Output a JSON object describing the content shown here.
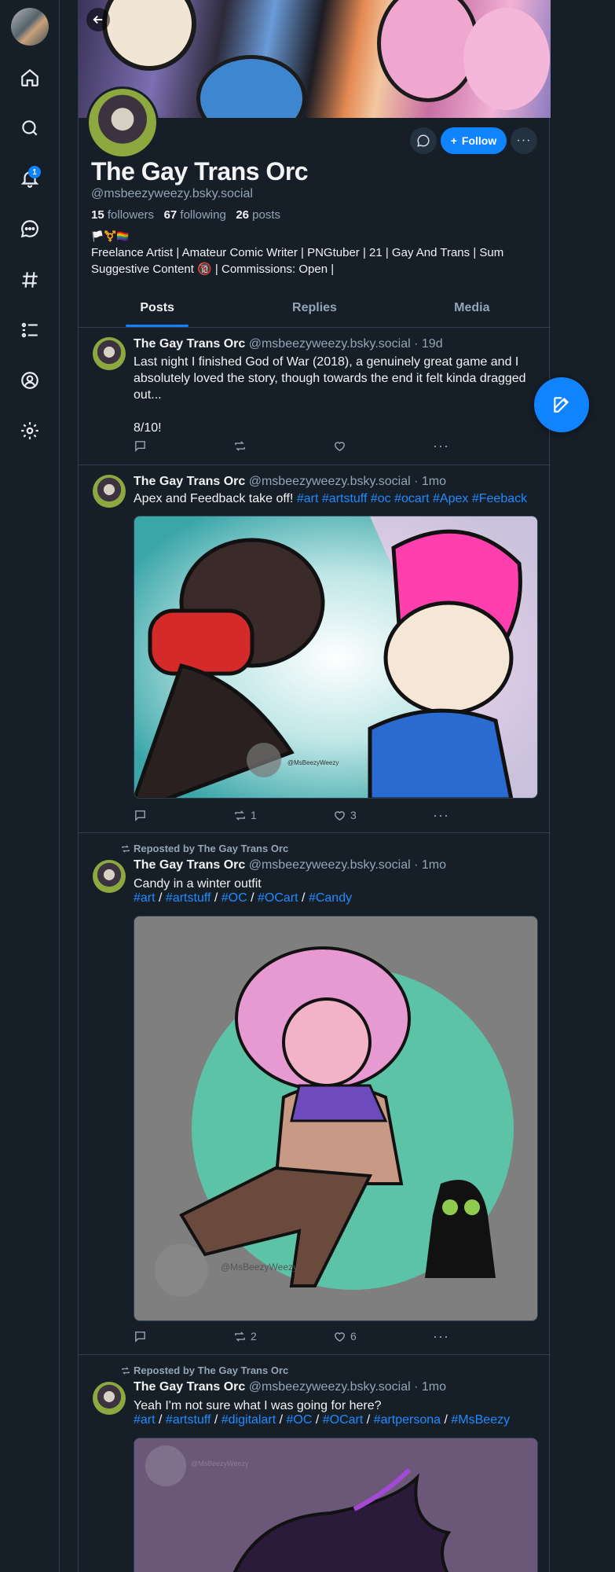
{
  "nav": {
    "notifications_badge": "1",
    "items": [
      "home-icon",
      "search-icon",
      "bell-icon",
      "chat-icon",
      "hashtag-icon",
      "list-icon",
      "profile-icon",
      "gear-icon"
    ]
  },
  "profile": {
    "display_name": "The Gay Trans Orc",
    "handle": "@msbeezyweezy.bsky.social",
    "followers_count": "15",
    "followers_label": "followers",
    "following_count": "67",
    "following_label": "following",
    "posts_count": "26",
    "posts_label": "posts",
    "flags": "🏳️⚧️🏳️‍🌈",
    "bio_line1": "Freelance Artist | Amateur Comic Writer | PNGtuber | 21 | Gay And Trans | Sum",
    "bio_line2": "Suggestive Content 🔞 | Commissions: Open |",
    "follow_label": "Follow"
  },
  "tabs": [
    "Posts",
    "Replies",
    "Media"
  ],
  "posts": [
    {
      "author": "The Gay Trans Orc",
      "meta": "@msbeezyweezy.bsky.social · 19d",
      "text": "Last night I finished God of War (2018), a genuinely great game and I absolutely loved the story, though towards the end it felt kinda dragged out...\n\n8/10!",
      "reposts": "",
      "likes": ""
    },
    {
      "author": "The Gay Trans Orc",
      "meta": "@msbeezyweezy.bsky.social · 1mo",
      "text": "Apex and Feedback take off!",
      "tags": [
        "#art",
        "#artstuff",
        "#oc",
        "#ocart",
        "#Apex",
        "#Feeback"
      ],
      "image_watermark": "@MsBeezyWeezy",
      "reposts": "1",
      "likes": "3"
    },
    {
      "repost_label": "Reposted by The Gay Trans Orc",
      "author": "The Gay Trans Orc",
      "meta": "@msbeezyweezy.bsky.social · 1mo",
      "text": "Candy in a winter outfit",
      "tags": [
        "#art",
        "#artstuff",
        "#OC",
        "#OCart",
        "#Candy"
      ],
      "image_watermark": "@MsBeezyWeezy",
      "reposts": "2",
      "likes": "6"
    },
    {
      "repost_label": "Reposted by The Gay Trans Orc",
      "author": "The Gay Trans Orc",
      "meta": "@msbeezyweezy.bsky.social · 1mo",
      "text": "Yeah I'm not sure what I was going for here?",
      "tags": [
        "#art",
        "#artstuff",
        "#digitalart",
        "#OC",
        "#OCart",
        "#artpersona",
        "#MsBeezy"
      ],
      "image_watermark": "@MsBeezyWeezy"
    }
  ],
  "colors": {
    "accent": "#1083fe",
    "link": "#208bfe",
    "background": "#161e27",
    "muted": "#93a5b7"
  }
}
